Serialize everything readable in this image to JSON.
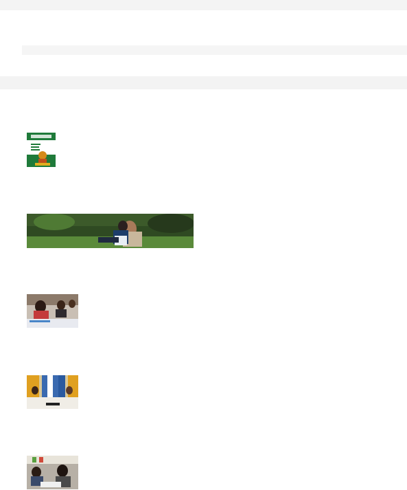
{
  "page": {
    "top_bar": {},
    "search_strip": {},
    "section_bar": {}
  },
  "items": [
    {
      "name": "book-cover-thumbnail",
      "kind": "illustrated book cover"
    },
    {
      "name": "family-outdoor-photo",
      "kind": "photo of a family sitting on grass"
    },
    {
      "name": "students-classroom-photo",
      "kind": "photo of students at desks"
    },
    {
      "name": "press-conference-photo",
      "kind": "photo of a panel in front of flags"
    },
    {
      "name": "children-learning-photo",
      "kind": "photo of children at a table"
    }
  ],
  "colors": {
    "bar_background": "#f4f4f4",
    "book_green": "#1f7a3a",
    "grass_green": "#5a8a3a"
  }
}
